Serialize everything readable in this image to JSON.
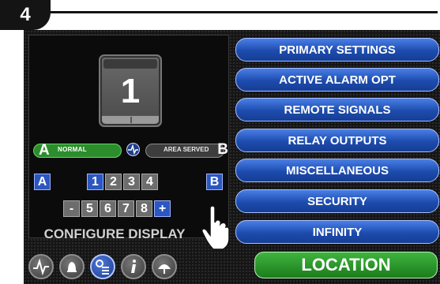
{
  "step_number": "4",
  "display": {
    "number": "1"
  },
  "indicators": {
    "a": {
      "letter": "A",
      "text": "NORMAL"
    },
    "b": {
      "letter": "B",
      "text": "AREA SERVED"
    }
  },
  "keypad": {
    "a_key": "A",
    "b_key": "B",
    "top_digits": [
      "1",
      "2",
      "3",
      "4"
    ],
    "minus": "-",
    "bottom_digits": [
      "5",
      "6",
      "7",
      "8"
    ],
    "plus": "+"
  },
  "configure_label": "CONFIGURE DISPLAY",
  "menu": [
    "PRIMARY SETTINGS",
    "ACTIVE ALARM OPT",
    "REMOTE SIGNALS",
    "RELAY OUTPUTS",
    "MISCELLANEOUS",
    "SECURITY",
    "INFINITY"
  ],
  "location_button": "LOCATION",
  "bottom_icons": [
    "waveform-icon",
    "bell-icon",
    "settings-list-icon",
    "info-icon",
    "fan-icon"
  ],
  "colors": {
    "menu_blue": "#2350b8",
    "location_green": "#2a9a2a",
    "normal_green": "#2c8d2c",
    "key_blue": "#2c56c0"
  }
}
